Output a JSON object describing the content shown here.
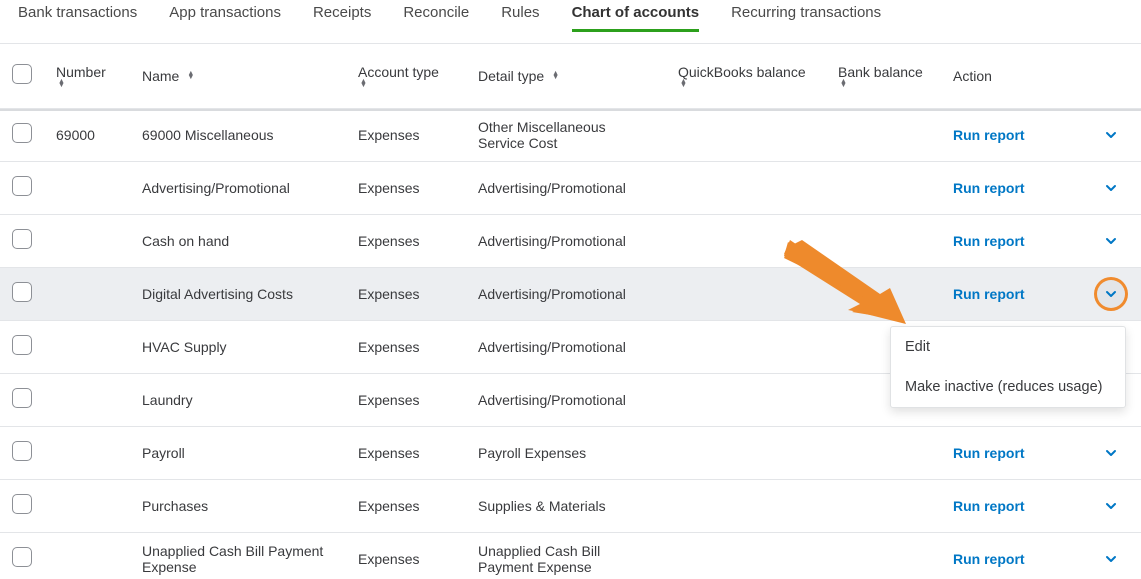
{
  "tabs": [
    {
      "label": "Bank transactions",
      "active": false
    },
    {
      "label": "App transactions",
      "active": false
    },
    {
      "label": "Receipts",
      "active": false
    },
    {
      "label": "Reconcile",
      "active": false
    },
    {
      "label": "Rules",
      "active": false
    },
    {
      "label": "Chart of accounts",
      "active": true
    },
    {
      "label": "Recurring transactions",
      "active": false
    }
  ],
  "columns": {
    "number": "Number",
    "name": "Name",
    "account_type": "Account type",
    "detail_type": "Detail type",
    "qb_balance": "QuickBooks balance",
    "bank_balance": "Bank balance",
    "action": "Action"
  },
  "action_label": "Run report",
  "dropdown_menu": {
    "edit": "Edit",
    "make_inactive": "Make inactive (reduces usage)"
  },
  "rows": [
    {
      "number": "69000",
      "name": "69000 Miscellaneous",
      "type": "Expenses",
      "detail": "Other Miscellaneous Service Cost",
      "qb": "",
      "bank": "",
      "highlight": false,
      "dropdown": false,
      "first": true
    },
    {
      "number": "",
      "name": "Advertising/Promotional",
      "type": "Expenses",
      "detail": "Advertising/Promotional",
      "qb": "",
      "bank": "",
      "highlight": false,
      "dropdown": false
    },
    {
      "number": "",
      "name": "Cash on hand",
      "type": "Expenses",
      "detail": "Advertising/Promotional",
      "qb": "",
      "bank": "",
      "highlight": false,
      "dropdown": false
    },
    {
      "number": "",
      "name": "Digital Advertising Costs",
      "type": "Expenses",
      "detail": "Advertising/Promotional",
      "qb": "",
      "bank": "",
      "highlight": true,
      "dropdown": true
    },
    {
      "number": "",
      "name": "HVAC Supply",
      "type": "Expenses",
      "detail": "Advertising/Promotional",
      "qb": "",
      "bank": "",
      "highlight": false,
      "dropdown": false
    },
    {
      "number": "",
      "name": "Laundry",
      "type": "Expenses",
      "detail": "Advertising/Promotional",
      "qb": "",
      "bank": "",
      "highlight": false,
      "dropdown": false
    },
    {
      "number": "",
      "name": "Payroll",
      "type": "Expenses",
      "detail": "Payroll Expenses",
      "qb": "",
      "bank": "",
      "highlight": false,
      "dropdown": false
    },
    {
      "number": "",
      "name": "Purchases",
      "type": "Expenses",
      "detail": "Supplies & Materials",
      "qb": "",
      "bank": "",
      "highlight": false,
      "dropdown": false
    },
    {
      "number": "",
      "name": "Unapplied Cash Bill Payment Expense",
      "type": "Expenses",
      "detail": "Unapplied Cash Bill Payment Expense",
      "qb": "",
      "bank": "",
      "highlight": false,
      "dropdown": false
    }
  ],
  "annotation": {
    "arrow_color": "#ee8a2c"
  }
}
